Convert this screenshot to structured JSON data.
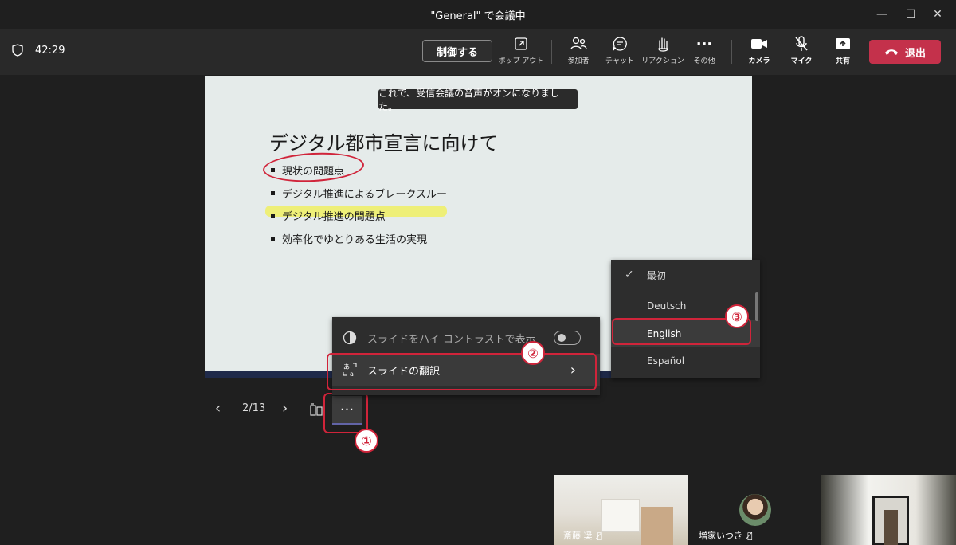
{
  "window": {
    "title": "\"General\" で会議中",
    "minimize": "—",
    "maximize": "☐",
    "close": "✕"
  },
  "toolbar": {
    "timer": "42:29",
    "control_label": "制御する",
    "popout": "ポップ アウト",
    "participants": "参加者",
    "chat": "チャット",
    "reactions": "リアクション",
    "more": "その他",
    "camera": "カメラ",
    "mic": "マイク",
    "share": "共有",
    "leave": "退出",
    "leave_color": "#c4314b"
  },
  "toast": "これで、受信会議の音声がオンになりました。",
  "slide": {
    "title": "デジタル都市宣言に向けて",
    "bullets": [
      "現状の問題点",
      "デジタル推進によるブレークスルー",
      "デジタル推進の問題点",
      "効率化でゆとりある生活の実現"
    ]
  },
  "nav": {
    "page": "2/13",
    "more": "···"
  },
  "menu": {
    "high_contrast": "スライドをハイ コントラストで表示",
    "translate": "スライドの翻訳"
  },
  "submenu": {
    "items": [
      "最初",
      "Deutsch",
      "English",
      "Español"
    ],
    "selected": "English"
  },
  "badges": {
    "one": "①",
    "two": "②",
    "three": "③"
  },
  "participants": [
    {
      "name": "斎藤 奨"
    },
    {
      "name": "増家いつき"
    }
  ]
}
